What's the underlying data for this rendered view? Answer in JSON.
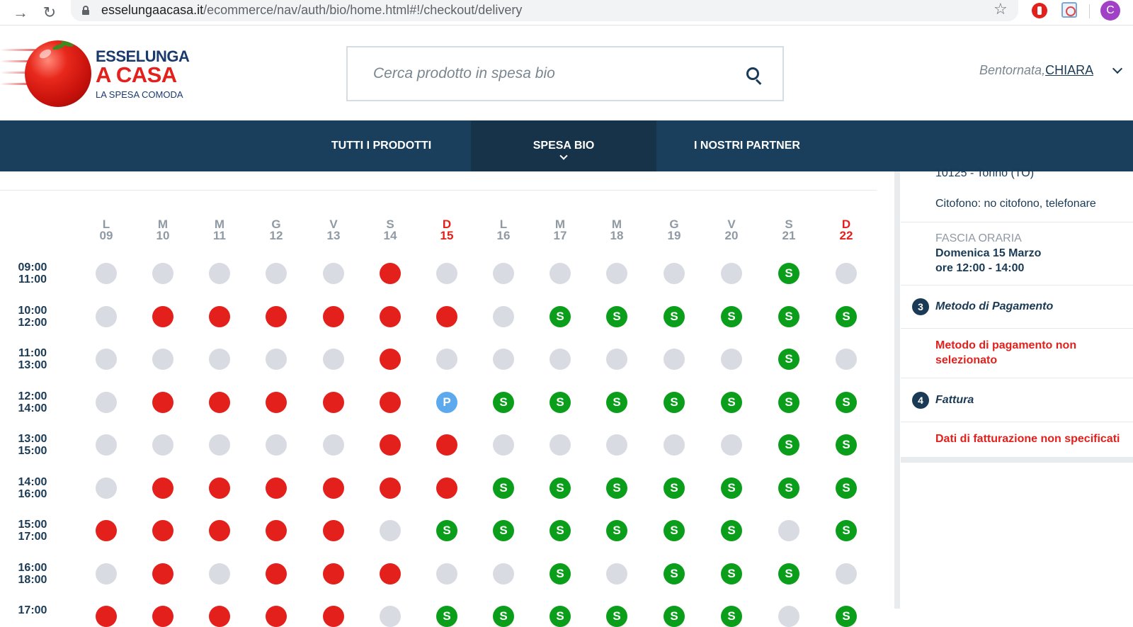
{
  "browser": {
    "url_host": "esselungaacasa.it",
    "url_path": "/ecommerce/nav/auth/bio/home.html#!/checkout/delivery",
    "profile_initial": "C"
  },
  "header": {
    "logo": {
      "line1": "ESSELUNGA",
      "line2": "A CASA",
      "line3": "LA SPESA COMODA"
    },
    "search_placeholder": "Cerca prodotto in spesa bio",
    "greeting": "Bentornata,",
    "user_name": "CHIARA"
  },
  "nav": {
    "items": [
      {
        "label": "TUTTI I PRODOTTI"
      },
      {
        "label": "SPESA BIO",
        "active": true
      },
      {
        "label": "I NOSTRI PARTNER"
      }
    ]
  },
  "calendar": {
    "days": [
      {
        "dow": "L",
        "day": "09"
      },
      {
        "dow": "M",
        "day": "10"
      },
      {
        "dow": "M",
        "day": "11"
      },
      {
        "dow": "G",
        "day": "12"
      },
      {
        "dow": "V",
        "day": "13"
      },
      {
        "dow": "S",
        "day": "14"
      },
      {
        "dow": "D",
        "day": "15",
        "sunday": true
      },
      {
        "dow": "L",
        "day": "16"
      },
      {
        "dow": "M",
        "day": "17"
      },
      {
        "dow": "M",
        "day": "18"
      },
      {
        "dow": "G",
        "day": "19"
      },
      {
        "dow": "V",
        "day": "20"
      },
      {
        "dow": "S",
        "day": "21"
      },
      {
        "dow": "D",
        "day": "22",
        "sunday": true
      }
    ],
    "legend_marks": {
      "s": "S",
      "p": "P"
    },
    "rows": [
      {
        "start": "09:00",
        "end": "11:00",
        "slots": [
          "g",
          "g",
          "g",
          "g",
          "g",
          "r",
          "g",
          "g",
          "g",
          "g",
          "g",
          "g",
          "s",
          "g"
        ]
      },
      {
        "start": "10:00",
        "end": "12:00",
        "slots": [
          "g",
          "r",
          "r",
          "r",
          "r",
          "r",
          "r",
          "g",
          "s",
          "s",
          "s",
          "s",
          "s",
          "s"
        ]
      },
      {
        "start": "11:00",
        "end": "13:00",
        "slots": [
          "g",
          "g",
          "g",
          "g",
          "g",
          "r",
          "g",
          "g",
          "g",
          "g",
          "g",
          "g",
          "s",
          "g"
        ]
      },
      {
        "start": "12:00",
        "end": "14:00",
        "slots": [
          "g",
          "r",
          "r",
          "r",
          "r",
          "r",
          "p",
          "s",
          "s",
          "s",
          "s",
          "s",
          "s",
          "s"
        ]
      },
      {
        "start": "13:00",
        "end": "15:00",
        "slots": [
          "g",
          "g",
          "g",
          "g",
          "g",
          "r",
          "r",
          "g",
          "g",
          "g",
          "g",
          "g",
          "s",
          "s"
        ]
      },
      {
        "start": "14:00",
        "end": "16:00",
        "slots": [
          "g",
          "r",
          "r",
          "r",
          "r",
          "r",
          "r",
          "s",
          "s",
          "s",
          "s",
          "s",
          "s",
          "s"
        ]
      },
      {
        "start": "15:00",
        "end": "17:00",
        "slots": [
          "r",
          "r",
          "r",
          "r",
          "r",
          "g",
          "s",
          "s",
          "s",
          "s",
          "s",
          "s",
          "g",
          "s"
        ]
      },
      {
        "start": "16:00",
        "end": "18:00",
        "slots": [
          "g",
          "r",
          "g",
          "r",
          "r",
          "r",
          "g",
          "g",
          "s",
          "g",
          "s",
          "s",
          "s",
          "g"
        ]
      },
      {
        "start": "17:00",
        "end": "",
        "slots": [
          "r",
          "r",
          "r",
          "r",
          "r",
          "g",
          "s",
          "s",
          "s",
          "s",
          "s",
          "s",
          "g",
          "s"
        ]
      }
    ]
  },
  "sidebar": {
    "address_tail": "10125 - Torino (TO)",
    "citofono": "Citofono: no citofono, telefonare",
    "fascia_label": "FASCIA ORARIA",
    "fascia_date": "Domenica 15 Marzo",
    "fascia_time": "ore 12:00 - 14:00",
    "step3": {
      "num": "3",
      "title": "Metodo di Pagamento",
      "status_line1": "Metodo di pagamento non",
      "status_line2": "selezionato"
    },
    "step4": {
      "num": "4",
      "title": "Fattura",
      "status": "Dati di fatturazione non specificati"
    }
  },
  "colors": {
    "brand_blue": "#1a3f5c",
    "red": "#e3201b",
    "green": "#0a9e1b",
    "blue_p": "#5da9ee",
    "grey": "#d8dbe2"
  }
}
